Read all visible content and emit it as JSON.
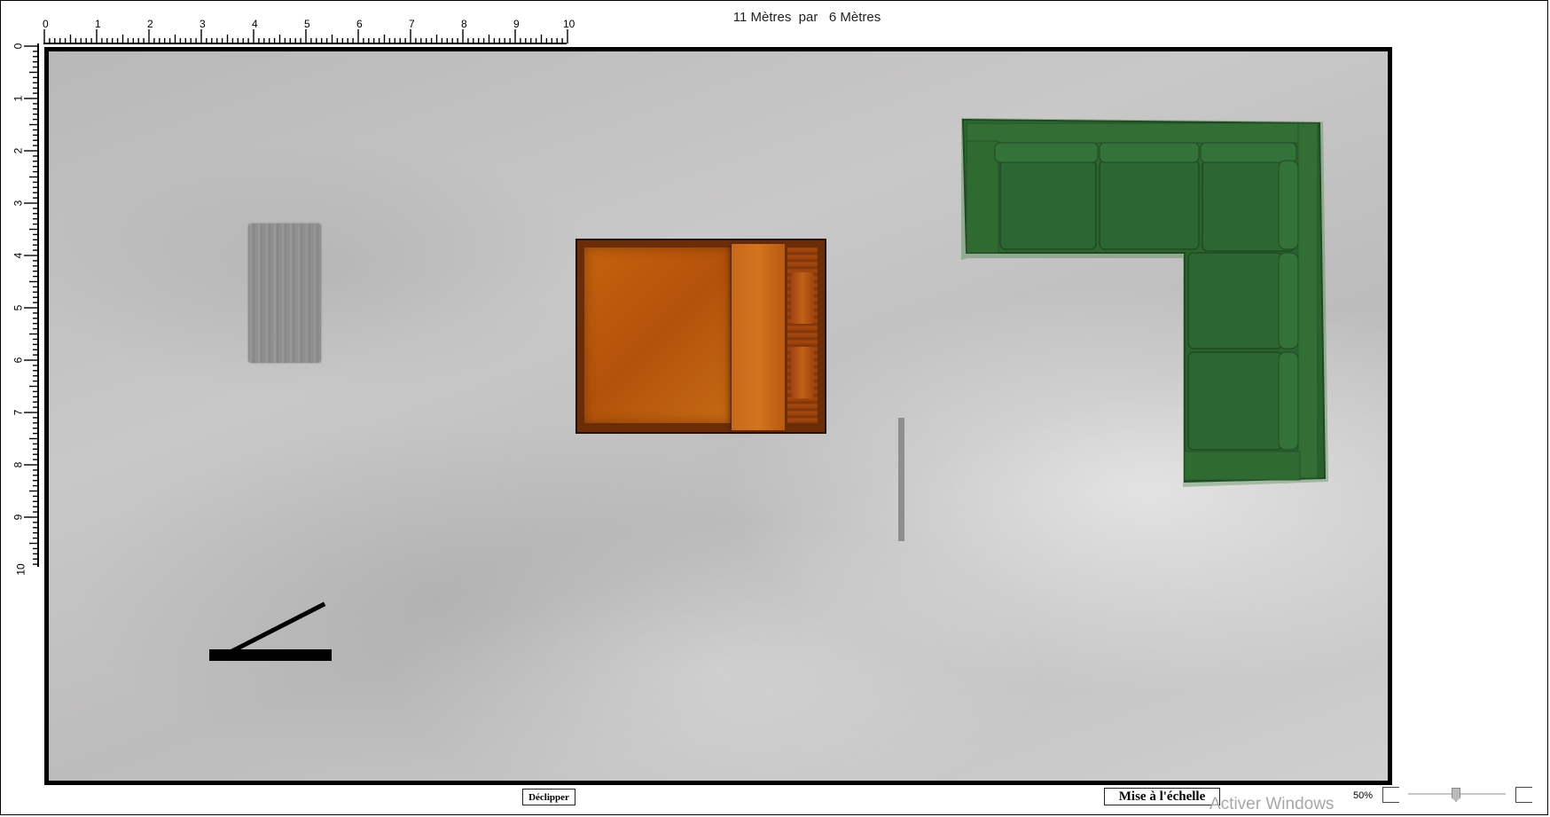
{
  "plan": {
    "title": "11 Mètres  par   6 Mètres",
    "ruler_top_labels": [
      "0",
      "1",
      "2",
      "3",
      "4",
      "5",
      "6",
      "7",
      "8",
      "9",
      "10"
    ],
    "ruler_left_labels": [
      "0",
      "1",
      "2",
      "3",
      "4",
      "5",
      "6",
      "7",
      "8",
      "9",
      "10"
    ]
  },
  "canvas": {
    "items": [
      "table",
      "bed",
      "divider",
      "corner-sofa",
      "scale-indicator"
    ],
    "colors": {
      "sofa": "#2f6b32",
      "bed": "#b5530b",
      "table": "#8e8e8e",
      "floor": "#c4c3c3"
    }
  },
  "controls": {
    "declip_label": "Déclipper",
    "scale_label": "Mise à l'échelle",
    "zoom_value": "50%",
    "zoom_level": 0.5
  },
  "watermark": "Activer Windows"
}
